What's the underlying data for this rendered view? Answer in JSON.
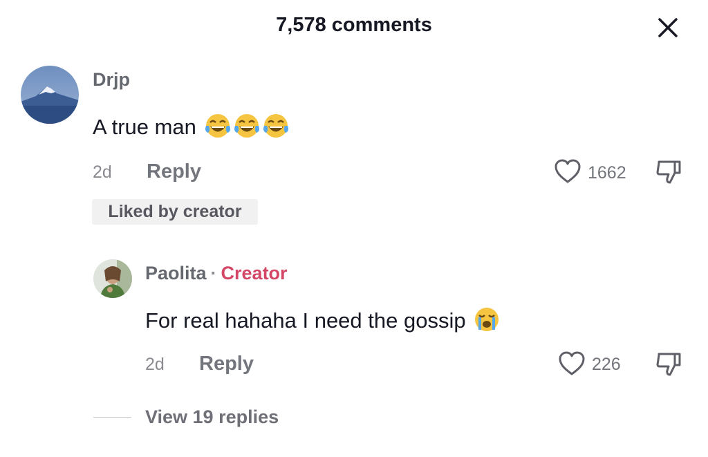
{
  "header": {
    "title": "7,578 comments",
    "close_icon": "close-icon"
  },
  "comment": {
    "username": "Drjp",
    "text": "A true man",
    "emojis": [
      "tears-of-joy-emoji",
      "tears-of-joy-emoji",
      "tears-of-joy-emoji"
    ],
    "time": "2d",
    "reply_label": "Reply",
    "like_count": "1662",
    "liked_badge": "Liked by creator"
  },
  "reply": {
    "username": "Paolita",
    "separator": "·",
    "creator_label": "Creator",
    "text": "For real hahaha I need the gossip",
    "emoji": "loudly-crying-emoji",
    "time": "2d",
    "reply_label": "Reply",
    "like_count": "226"
  },
  "view_replies": "View 19 replies",
  "colors": {
    "creator": "#d34666",
    "text": "#161823",
    "muted": "#73757c"
  }
}
